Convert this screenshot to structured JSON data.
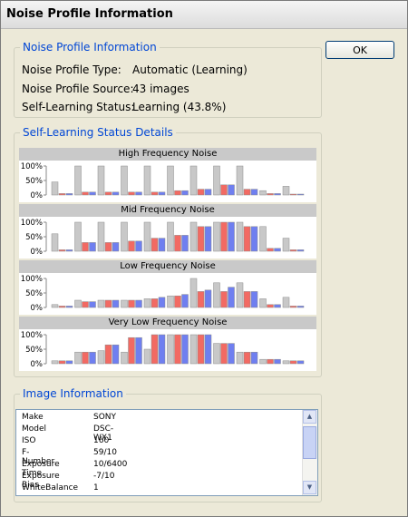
{
  "window": {
    "title": "Noise Profile Information"
  },
  "ok_button": {
    "label": "OK"
  },
  "profile_info": {
    "group_title": "Noise Profile Information",
    "rows": [
      {
        "label": "Noise Profile Type:",
        "value": "Automatic (Learning)"
      },
      {
        "label": "Noise Profile Source:",
        "value": "43 images"
      },
      {
        "label": "Self-Learning Status:",
        "value": "Learning (43.8%)"
      }
    ]
  },
  "status_details": {
    "group_title": "Self-Learning Status Details",
    "chart_data": [
      {
        "type": "bar",
        "title": "High Frequency Noise",
        "yticks": [
          "100%",
          "50%",
          "0%"
        ],
        "ylim": [
          0,
          100
        ],
        "colors": {
          "gray": "#c8c8c8",
          "red": "#f26a63",
          "blue": "#6f7ff0"
        },
        "groups": [
          {
            "gray": 45,
            "red": 5,
            "blue": 5
          },
          {
            "gray": 100,
            "red": 10,
            "blue": 10
          },
          {
            "gray": 100,
            "red": 10,
            "blue": 10
          },
          {
            "gray": 100,
            "red": 10,
            "blue": 10
          },
          {
            "gray": 100,
            "red": 10,
            "blue": 10
          },
          {
            "gray": 100,
            "red": 15,
            "blue": 15
          },
          {
            "gray": 100,
            "red": 20,
            "blue": 20
          },
          {
            "gray": 100,
            "red": 35,
            "blue": 35
          },
          {
            "gray": 100,
            "red": 20,
            "blue": 20
          },
          {
            "gray": 15,
            "red": 5,
            "blue": 5
          },
          {
            "gray": 30,
            "red": 3,
            "blue": 3
          }
        ]
      },
      {
        "type": "bar",
        "title": "Mid Frequency Noise",
        "yticks": [
          "100%",
          "50%",
          "0%"
        ],
        "ylim": [
          0,
          100
        ],
        "colors": {
          "gray": "#c8c8c8",
          "red": "#f26a63",
          "blue": "#6f7ff0"
        },
        "groups": [
          {
            "gray": 60,
            "red": 5,
            "blue": 5
          },
          {
            "gray": 100,
            "red": 30,
            "blue": 30
          },
          {
            "gray": 100,
            "red": 30,
            "blue": 30
          },
          {
            "gray": 100,
            "red": 35,
            "blue": 35
          },
          {
            "gray": 100,
            "red": 45,
            "blue": 45
          },
          {
            "gray": 100,
            "red": 55,
            "blue": 55
          },
          {
            "gray": 100,
            "red": 85,
            "blue": 85
          },
          {
            "gray": 100,
            "red": 100,
            "blue": 100
          },
          {
            "gray": 100,
            "red": 85,
            "blue": 85
          },
          {
            "gray": 85,
            "red": 10,
            "blue": 10
          },
          {
            "gray": 45,
            "red": 5,
            "blue": 5
          }
        ]
      },
      {
        "type": "bar",
        "title": "Low Frequency Noise",
        "yticks": [
          "100%",
          "50%",
          "0%"
        ],
        "ylim": [
          0,
          100
        ],
        "colors": {
          "gray": "#c8c8c8",
          "red": "#f26a63",
          "blue": "#6f7ff0"
        },
        "groups": [
          {
            "gray": 10,
            "red": 5,
            "blue": 5
          },
          {
            "gray": 25,
            "red": 20,
            "blue": 20
          },
          {
            "gray": 25,
            "red": 25,
            "blue": 25
          },
          {
            "gray": 25,
            "red": 25,
            "blue": 25
          },
          {
            "gray": 30,
            "red": 30,
            "blue": 35
          },
          {
            "gray": 40,
            "red": 40,
            "blue": 45
          },
          {
            "gray": 100,
            "red": 55,
            "blue": 60
          },
          {
            "gray": 85,
            "red": 55,
            "blue": 70
          },
          {
            "gray": 85,
            "red": 55,
            "blue": 55
          },
          {
            "gray": 30,
            "red": 10,
            "blue": 10
          },
          {
            "gray": 35,
            "red": 5,
            "blue": 5
          }
        ]
      },
      {
        "type": "bar",
        "title": "Very Low Frequency Noise",
        "yticks": [
          "100%",
          "50%",
          "0%"
        ],
        "ylim": [
          0,
          100
        ],
        "colors": {
          "gray": "#c8c8c8",
          "red": "#f26a63",
          "blue": "#6f7ff0"
        },
        "groups": [
          {
            "gray": 10,
            "red": 10,
            "blue": 10
          },
          {
            "gray": 40,
            "red": 40,
            "blue": 40
          },
          {
            "gray": 45,
            "red": 65,
            "blue": 65
          },
          {
            "gray": 40,
            "red": 90,
            "blue": 90
          },
          {
            "gray": 50,
            "red": 100,
            "blue": 100
          },
          {
            "gray": 100,
            "red": 100,
            "blue": 100
          },
          {
            "gray": 100,
            "red": 100,
            "blue": 100
          },
          {
            "gray": 70,
            "red": 70,
            "blue": 70
          },
          {
            "gray": 40,
            "red": 40,
            "blue": 40
          },
          {
            "gray": 15,
            "red": 15,
            "blue": 15
          },
          {
            "gray": 10,
            "red": 10,
            "blue": 10
          }
        ]
      }
    ]
  },
  "image_info": {
    "group_title": "Image Information",
    "rows": [
      {
        "key": "Make",
        "value": "SONY"
      },
      {
        "key": "Model",
        "value": "DSC-WX1"
      },
      {
        "key": "ISO",
        "value": "160"
      },
      {
        "key": "F-Number",
        "value": "59/10"
      },
      {
        "key": "Exposure Time",
        "value": "10/6400"
      },
      {
        "key": "Exposure Bias",
        "value": "-7/10"
      },
      {
        "key": "WhiteBalance",
        "value": "1"
      }
    ],
    "scrollbar": {
      "up_icon": "arrow-up-icon",
      "down_icon": "arrow-down-icon"
    }
  }
}
